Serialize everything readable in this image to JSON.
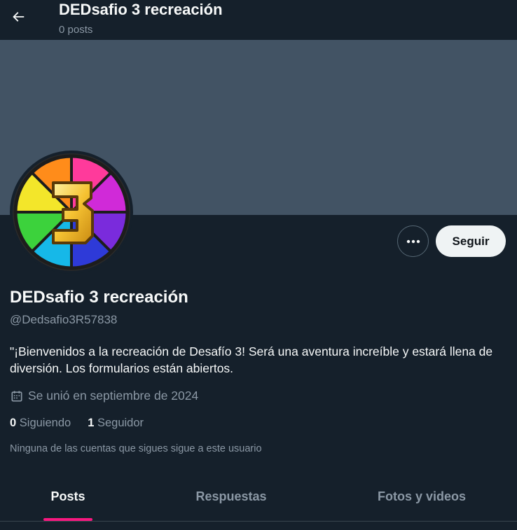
{
  "header": {
    "title": "DEDsafio 3 recreación",
    "posts_count": "0 posts"
  },
  "profile": {
    "display_name": "DEDsafio 3 recreación",
    "handle": "@Dedsafio3R57838",
    "bio": "\"¡Bienvenidos a la recreación de Desafío 3! Será una aventura increíble y estará llena de diversión. Los formularios están abiertos.",
    "joined": "Se unió en septiembre de 2024",
    "following_count": "0",
    "following_label": "Siguiendo",
    "followers_count": "1",
    "followers_label": "Seguidor",
    "followers_note": "Ninguna de las cuentas que sigues sigue a este usuario"
  },
  "actions": {
    "follow_label": "Seguir"
  },
  "tabs": [
    {
      "label": "Posts",
      "active": true
    },
    {
      "label": "Respuestas",
      "active": false
    },
    {
      "label": "Fotos y videos",
      "active": false
    }
  ],
  "colors": {
    "background": "#15202b",
    "banner": "#425364",
    "accent_tab": "#f91880",
    "secondary_text": "#8b98a5"
  },
  "icons": {
    "back": "arrow-left-icon",
    "more": "more-dots-icon",
    "calendar": "calendar-icon"
  }
}
